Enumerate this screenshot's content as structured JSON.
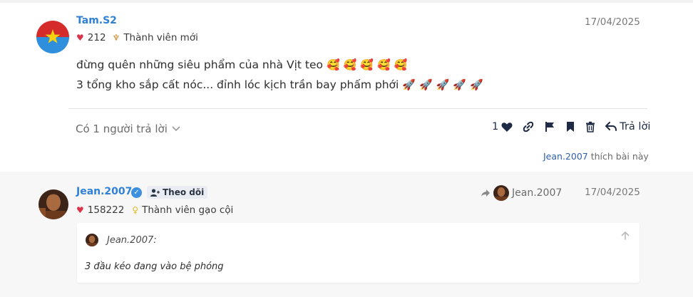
{
  "post1": {
    "username": "Tam.S2",
    "likes_received": "212",
    "rank": "Thành viên mới",
    "date": "17/04/2025",
    "line1": "đừng quên những siêu phẩm của nhà Vịt teo",
    "line1_emoji": "🥰",
    "line2": "3 tổng kho sắp cất nóc... đỉnh lóc kịch trần bay phấm phới",
    "line2_emoji": "🚀",
    "replies_label": "Có 1 người trả lời",
    "like_count": "1",
    "liked_by": "Jean.2007",
    "liked_suffix": "thích bài này"
  },
  "post2": {
    "username": "Jean.2007",
    "follow_label": "Theo dõi",
    "likes_received": "158222",
    "rank": "Thành viên gạo cội",
    "reposted_from": "Jean.2007",
    "date": "17/04/2025",
    "quote_author": "Jean.2007:",
    "quote_text": "3 đầu kéo đang vào bệ phóng"
  },
  "colors": {
    "username": "#2f80d6",
    "heart": "#d9334a",
    "action_icons": "#1f2a44"
  }
}
